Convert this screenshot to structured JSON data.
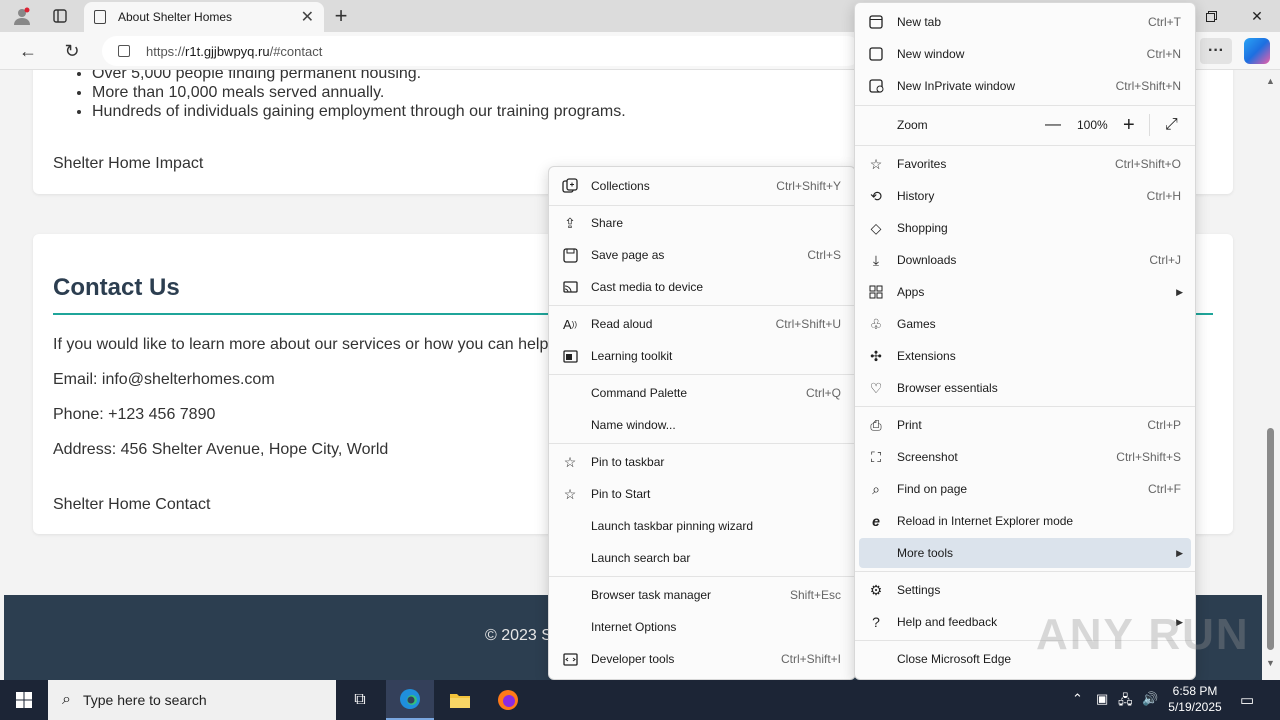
{
  "browser": {
    "tab_title": "About Shelter Homes",
    "url_prefix": "https://",
    "url_domain": "r1t.gjjbwpyq.ru",
    "url_path": "/#contact"
  },
  "page": {
    "impact_items": [
      "Over 5,000 people finding permanent housing.",
      "More than 10,000 meals served annually.",
      "Hundreds of individuals gaining employment through our training programs."
    ],
    "impact_image_alt": "Shelter Home Impact",
    "contact_title": "Contact Us",
    "contact_intro": "If you would like to learn more about our services or how you can help, ple",
    "contact_email": "Email: info@shelterhomes.com",
    "contact_phone": "Phone: +123 456 7890",
    "contact_address": "Address: 456 Shelter Avenue, Hope City, World",
    "contact_image_alt": "Shelter Home Contact",
    "footer_text": "© 2023 S"
  },
  "main_menu": {
    "new_tab": {
      "label": "New tab",
      "shortcut": "Ctrl+T"
    },
    "new_window": {
      "label": "New window",
      "shortcut": "Ctrl+N"
    },
    "new_inprivate": {
      "label": "New InPrivate window",
      "shortcut": "Ctrl+Shift+N"
    },
    "zoom": {
      "label": "Zoom",
      "value": "100%",
      "minus": "—",
      "plus": "+"
    },
    "favorites": {
      "label": "Favorites",
      "shortcut": "Ctrl+Shift+O"
    },
    "history": {
      "label": "History",
      "shortcut": "Ctrl+H"
    },
    "shopping": {
      "label": "Shopping"
    },
    "downloads": {
      "label": "Downloads",
      "shortcut": "Ctrl+J"
    },
    "apps": {
      "label": "Apps"
    },
    "games": {
      "label": "Games"
    },
    "extensions": {
      "label": "Extensions"
    },
    "browser_essentials": {
      "label": "Browser essentials"
    },
    "print": {
      "label": "Print",
      "shortcut": "Ctrl+P"
    },
    "screenshot": {
      "label": "Screenshot",
      "shortcut": "Ctrl+Shift+S"
    },
    "find": {
      "label": "Find on page",
      "shortcut": "Ctrl+F"
    },
    "ie_mode": {
      "label": "Reload in Internet Explorer mode"
    },
    "more_tools": {
      "label": "More tools"
    },
    "settings": {
      "label": "Settings"
    },
    "help": {
      "label": "Help and feedback"
    },
    "close_edge": {
      "label": "Close Microsoft Edge"
    }
  },
  "more_tools_menu": {
    "collections": {
      "label": "Collections",
      "shortcut": "Ctrl+Shift+Y"
    },
    "share": {
      "label": "Share"
    },
    "save_page": {
      "label": "Save page as",
      "shortcut": "Ctrl+S"
    },
    "cast": {
      "label": "Cast media to device"
    },
    "read_aloud": {
      "label": "Read aloud",
      "shortcut": "Ctrl+Shift+U"
    },
    "learning_toolkit": {
      "label": "Learning toolkit"
    },
    "command_palette": {
      "label": "Command Palette",
      "shortcut": "Ctrl+Q"
    },
    "name_window": {
      "label": "Name window..."
    },
    "pin_taskbar": {
      "label": "Pin to taskbar"
    },
    "pin_start": {
      "label": "Pin to Start"
    },
    "pin_wizard": {
      "label": "Launch taskbar pinning wizard"
    },
    "search_bar": {
      "label": "Launch search bar"
    },
    "task_manager": {
      "label": "Browser task manager",
      "shortcut": "Shift+Esc"
    },
    "internet_options": {
      "label": "Internet Options"
    },
    "dev_tools": {
      "label": "Developer tools",
      "shortcut": "Ctrl+Shift+I"
    }
  },
  "taskbar": {
    "search_placeholder": "Type here to search",
    "time": "6:58 PM",
    "date": "5/19/2025"
  },
  "watermark": "ANY RUN",
  "colors": {
    "accent_rule": "#1fa59a",
    "footer_bg": "#2c3e50",
    "highlight": "#dbe3ec",
    "taskbar_bg": "#1c2536"
  }
}
